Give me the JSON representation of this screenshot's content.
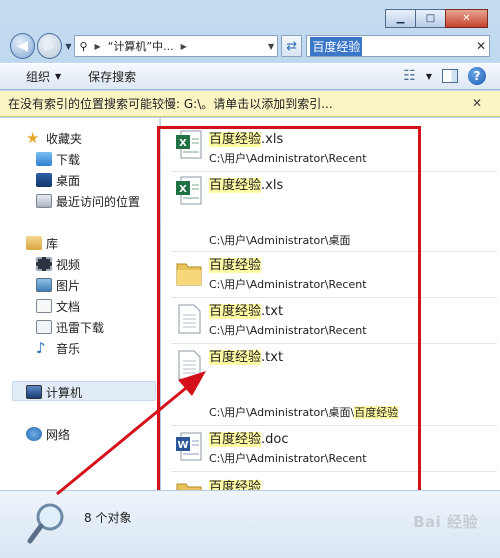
{
  "nav": {
    "address_segments": [
      "“计算机”中..."
    ],
    "search_value": "百度经验"
  },
  "toolbar": {
    "organize": "组织",
    "save_search": "保存搜索"
  },
  "infobar": {
    "text": "在没有索引的位置搜索可能较慢: G:\\。请单击以添加到索引..."
  },
  "sidebar": {
    "favorites": "收藏夹",
    "fav_items": [
      "下载",
      "桌面",
      "最近访问的位置"
    ],
    "libraries": "库",
    "lib_items": [
      "视频",
      "图片",
      "文档",
      "迅雷下载",
      "音乐"
    ],
    "computer": "计算机",
    "network": "网络"
  },
  "results": [
    {
      "pre": "",
      "hl": "百度经验",
      "post": ".xls",
      "path": "C:\\用户\\Administrator\\Recent",
      "path_hl": "",
      "icon": "excel-file-icon"
    },
    {
      "pre": "",
      "hl": "百度经验",
      "post": ".xls",
      "path": "C:\\用户\\Administrator\\桌面",
      "path_hl": "",
      "icon": "excel-file-icon"
    },
    {
      "pre": "",
      "hl": "百度经验",
      "post": "",
      "path": "C:\\用户\\Administrator\\Recent",
      "path_hl": "",
      "icon": "folder-icon"
    },
    {
      "pre": "",
      "hl": "百度经验",
      "post": ".txt",
      "path": "C:\\用户\\Administrator\\Recent",
      "path_hl": "",
      "icon": "text-file-icon"
    },
    {
      "pre": "",
      "hl": "百度经验",
      "post": ".txt",
      "path": "C:\\用户\\Administrator\\桌面\\",
      "path_hl": "百度经验",
      "icon": "text-file-icon"
    },
    {
      "pre": "",
      "hl": "百度经验",
      "post": ".doc",
      "path": "C:\\用户\\Administrator\\Recent",
      "path_hl": "",
      "icon": "word-file-icon"
    },
    {
      "pre": "",
      "hl": "百度经验",
      "post": "",
      "path": "",
      "path_hl": "",
      "icon": "folder-icon"
    }
  ],
  "details": {
    "count": "8 个对象"
  },
  "watermark": "Bai 经验",
  "colors": {
    "annotation_red": "#d4111a",
    "highlight": "#fffaa4"
  }
}
